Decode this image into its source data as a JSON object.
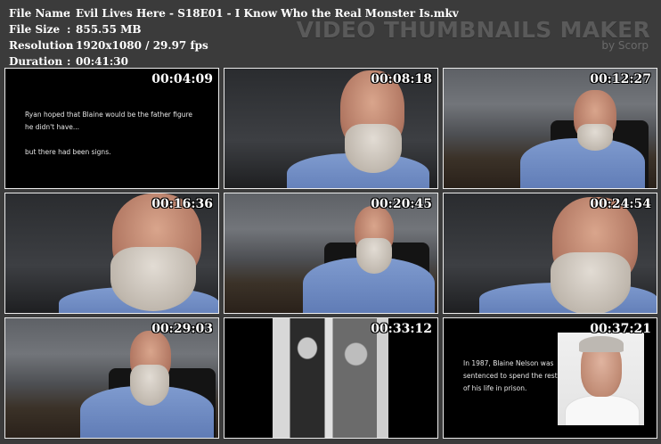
{
  "info": {
    "rows": [
      {
        "key": "File Name",
        "sep": ":",
        "value": "Evil Lives Here - S18E01 - I Know Who the Real Monster Is.mkv"
      },
      {
        "key": "File Size",
        "sep": ":",
        "value": "855.55 MB"
      },
      {
        "key": "Resolution",
        "sep": ":",
        "value": "1920x1080 / 29.97 fps"
      },
      {
        "key": "Duration",
        "sep": ":",
        "value": "00:41:30"
      }
    ]
  },
  "brand": {
    "title": "VIDEO THUMBNAILS MAKER",
    "by": "by Scorp"
  },
  "thumbnails": [
    {
      "timestamp": "00:04:09",
      "caption_lines": [
        "Ryan hoped that Blaine would be the father figure",
        "he didn't have...",
        "",
        "but there had been signs."
      ]
    },
    {
      "timestamp": "00:08:18"
    },
    {
      "timestamp": "00:12:27"
    },
    {
      "timestamp": "00:16:36"
    },
    {
      "timestamp": "00:20:45"
    },
    {
      "timestamp": "00:24:54"
    },
    {
      "timestamp": "00:29:03"
    },
    {
      "timestamp": "00:33:12"
    },
    {
      "timestamp": "00:37:21",
      "caption_lines": [
        "In 1987, Blaine Nelson was",
        "sentenced to spend the rest",
        "of his life in prison."
      ]
    }
  ]
}
